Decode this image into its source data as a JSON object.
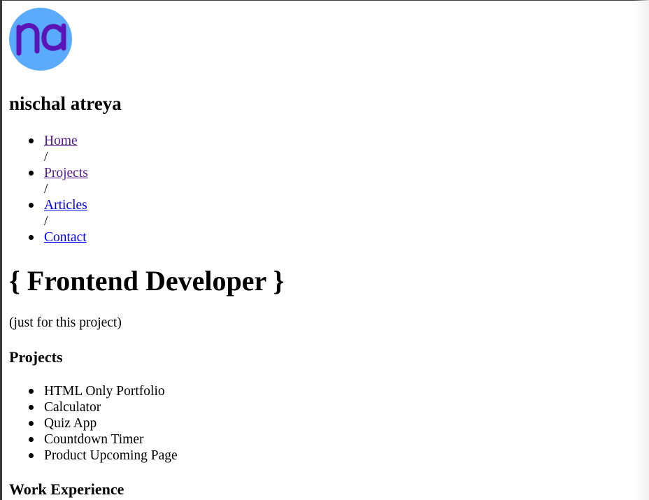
{
  "header": {
    "logo_text": "na",
    "logo_colors": {
      "circle": "#5aabfd",
      "letters": "#5b14b8"
    },
    "site_name": "nischal atreya"
  },
  "nav": {
    "items": [
      {
        "label": "Home",
        "state": "visited"
      },
      {
        "label": "Projects",
        "state": "visited"
      },
      {
        "label": "Articles",
        "state": "unvisited"
      },
      {
        "label": "Contact",
        "state": "unvisited"
      }
    ],
    "separator": "/",
    "colors": {
      "visited": "#551a8b",
      "unvisited": "#0000ee"
    }
  },
  "hero": {
    "title": "{ Frontend Developer }",
    "note": "(just for this project)"
  },
  "projects": {
    "heading": "Projects",
    "items": [
      "HTML Only Portfolio",
      "Calculator",
      "Quiz App",
      "Countdown Timer",
      "Product Upcoming Page"
    ]
  },
  "work": {
    "heading": "Work Experience"
  }
}
